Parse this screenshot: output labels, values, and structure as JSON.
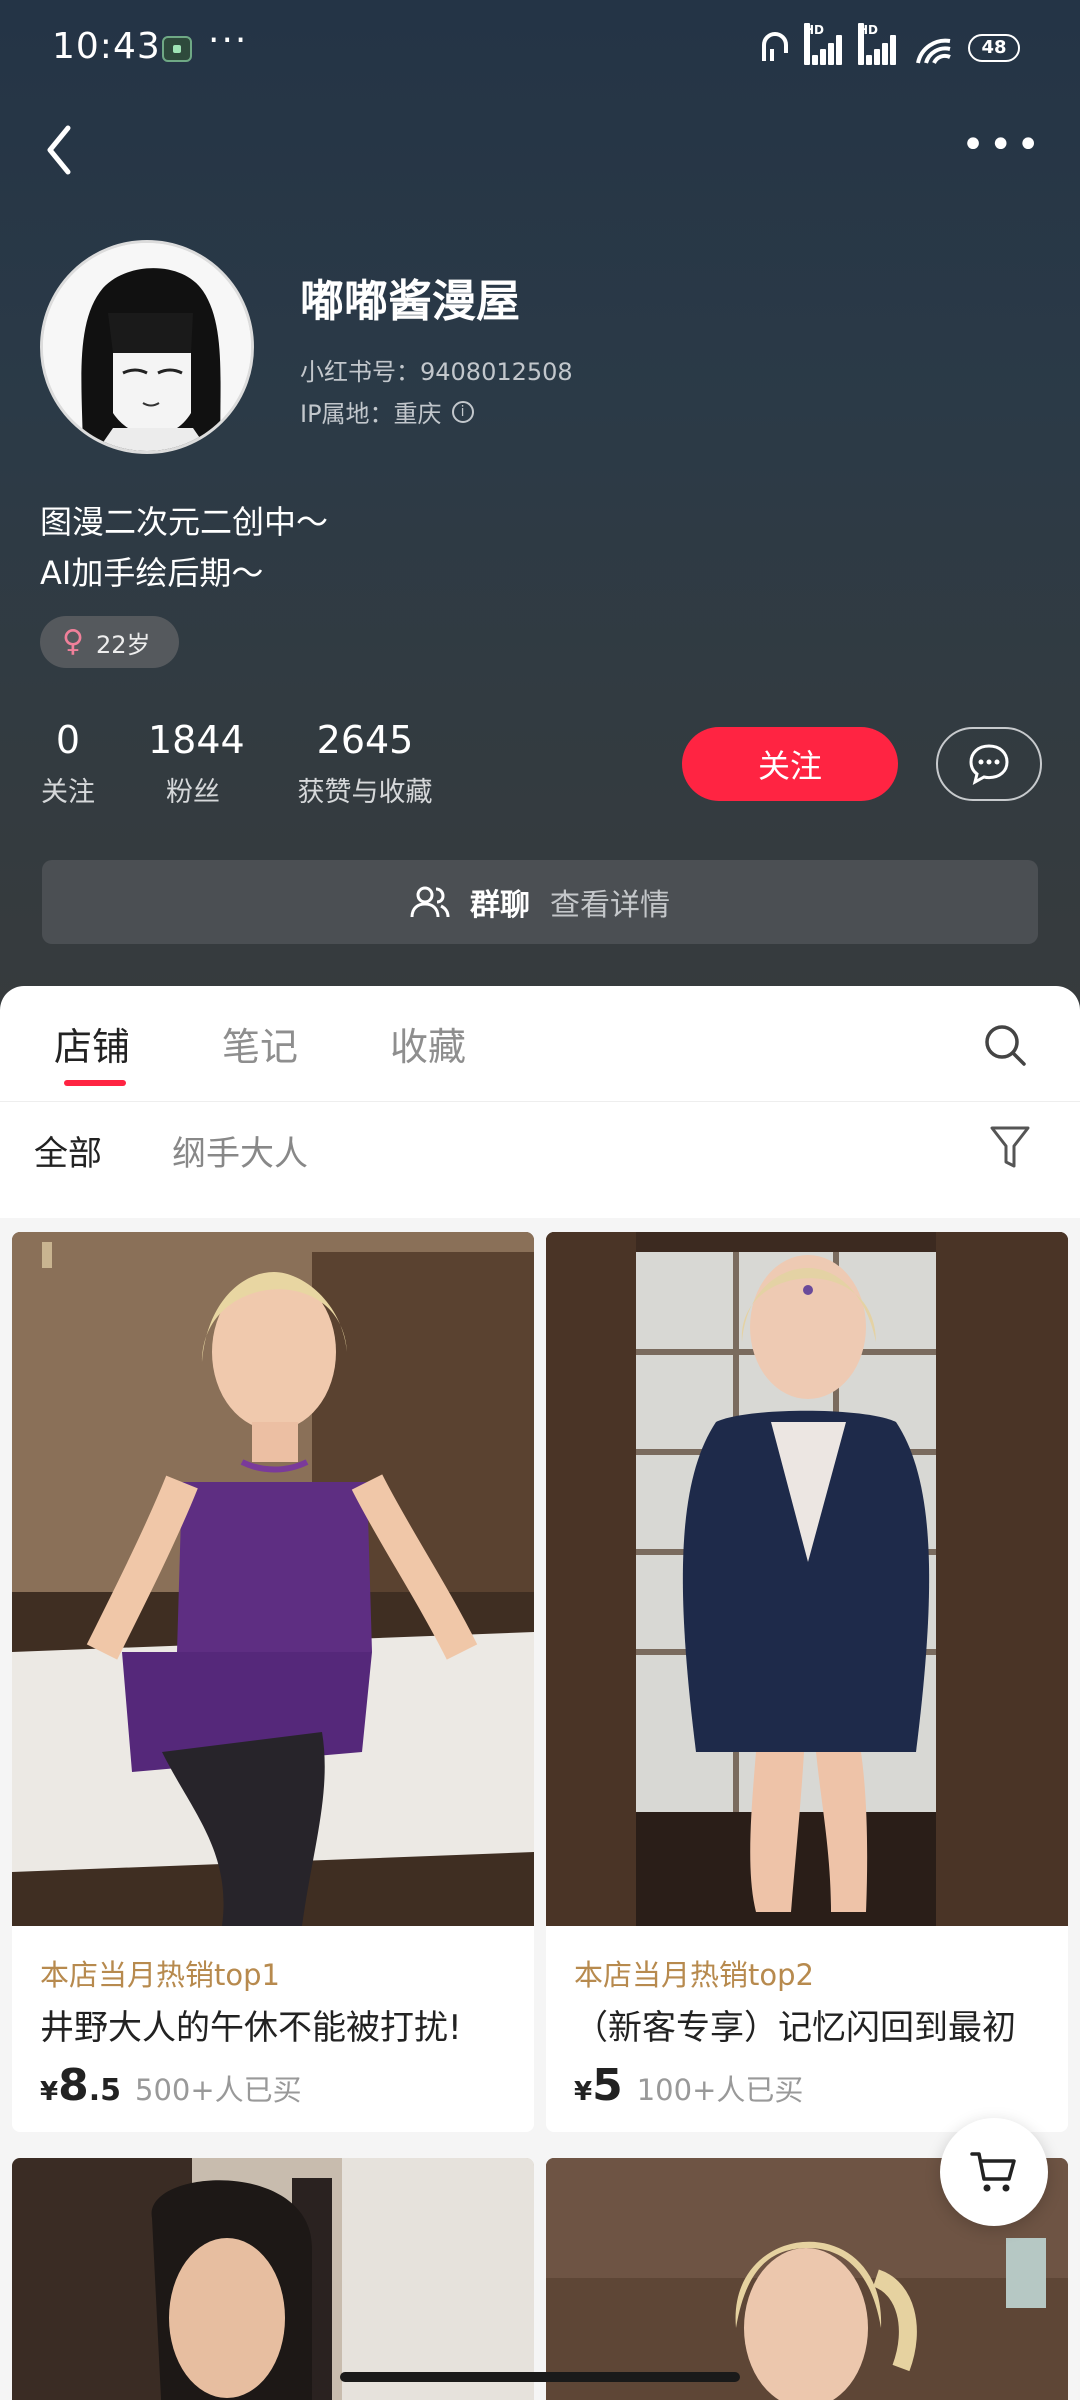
{
  "status_bar": {
    "time": "10:43",
    "battery": "48"
  },
  "profile": {
    "name": "嘟嘟酱漫屋",
    "id_label": "小红书号：9408012508",
    "ip_label": "IP属地：重庆",
    "bio": [
      "图漫二次元二创中～",
      "AI加手绘后期～"
    ],
    "age": "22岁",
    "stats": [
      {
        "num": "0",
        "label": "关注"
      },
      {
        "num": "1844",
        "label": "粉丝"
      },
      {
        "num": "2645",
        "label": "获赞与收藏"
      }
    ],
    "follow_label": "关注",
    "group_label": "群聊",
    "group_detail": "查看详情"
  },
  "tabs": [
    {
      "label": "店铺",
      "active": true
    },
    {
      "label": "笔记",
      "active": false
    },
    {
      "label": "收藏",
      "active": false
    }
  ],
  "filters": [
    {
      "label": "全部",
      "active": true
    },
    {
      "label": "纲手大人",
      "active": false
    }
  ],
  "products": [
    {
      "hot": "本店当月热销top1",
      "title": "井野大人的午休不能被打扰!",
      "price_symbol": "¥",
      "price_int": "8",
      "price_dec": ".5",
      "sold": "500+人已买"
    },
    {
      "hot": "本店当月热销top2",
      "title": "（新客专享）记忆闪回到最初",
      "price_symbol": "¥",
      "price_int": "5",
      "price_dec": "",
      "sold": "100+人已买"
    }
  ],
  "colors": {
    "accent": "#ff2442",
    "hot_label": "#b78a4e"
  }
}
